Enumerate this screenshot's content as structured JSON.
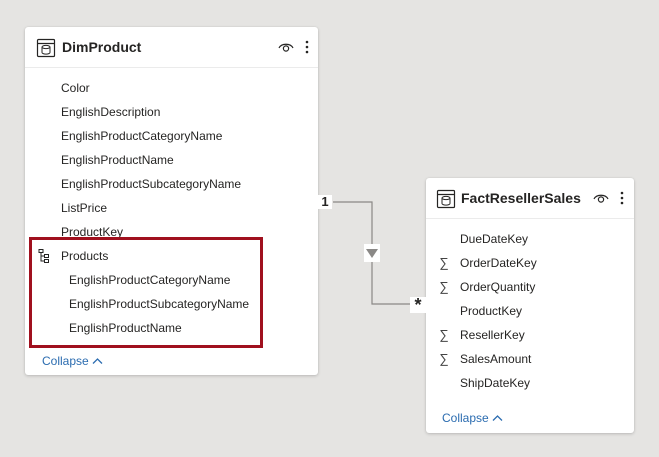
{
  "dim_product": {
    "title": "DimProduct",
    "fields": [
      "Color",
      "EnglishDescription",
      "EnglishProductCategoryName",
      "EnglishProductName",
      "EnglishProductSubcategoryName",
      "ListPrice",
      "ProductKey"
    ],
    "hierarchy": {
      "name": "Products",
      "levels": [
        "EnglishProductCategoryName",
        "EnglishProductSubcategoryName",
        "EnglishProductName"
      ]
    },
    "collapse_label": "Collapse"
  },
  "fact_reseller_sales": {
    "title": "FactResellerSales",
    "fields": [
      {
        "name": "DueDateKey",
        "summarized": false
      },
      {
        "name": "OrderDateKey",
        "summarized": true
      },
      {
        "name": "OrderQuantity",
        "summarized": true
      },
      {
        "name": "ProductKey",
        "summarized": false
      },
      {
        "name": "ResellerKey",
        "summarized": true
      },
      {
        "name": "SalesAmount",
        "summarized": true
      },
      {
        "name": "ShipDateKey",
        "summarized": false
      }
    ],
    "collapse_label": "Collapse"
  },
  "relationship": {
    "one_side": "1",
    "many_side": "*",
    "filter_direction": "single"
  },
  "colors": {
    "canvas": "#e5e4e2",
    "highlight_border": "#a0101e",
    "link": "#2b6cb0",
    "line": "#8a8886"
  }
}
